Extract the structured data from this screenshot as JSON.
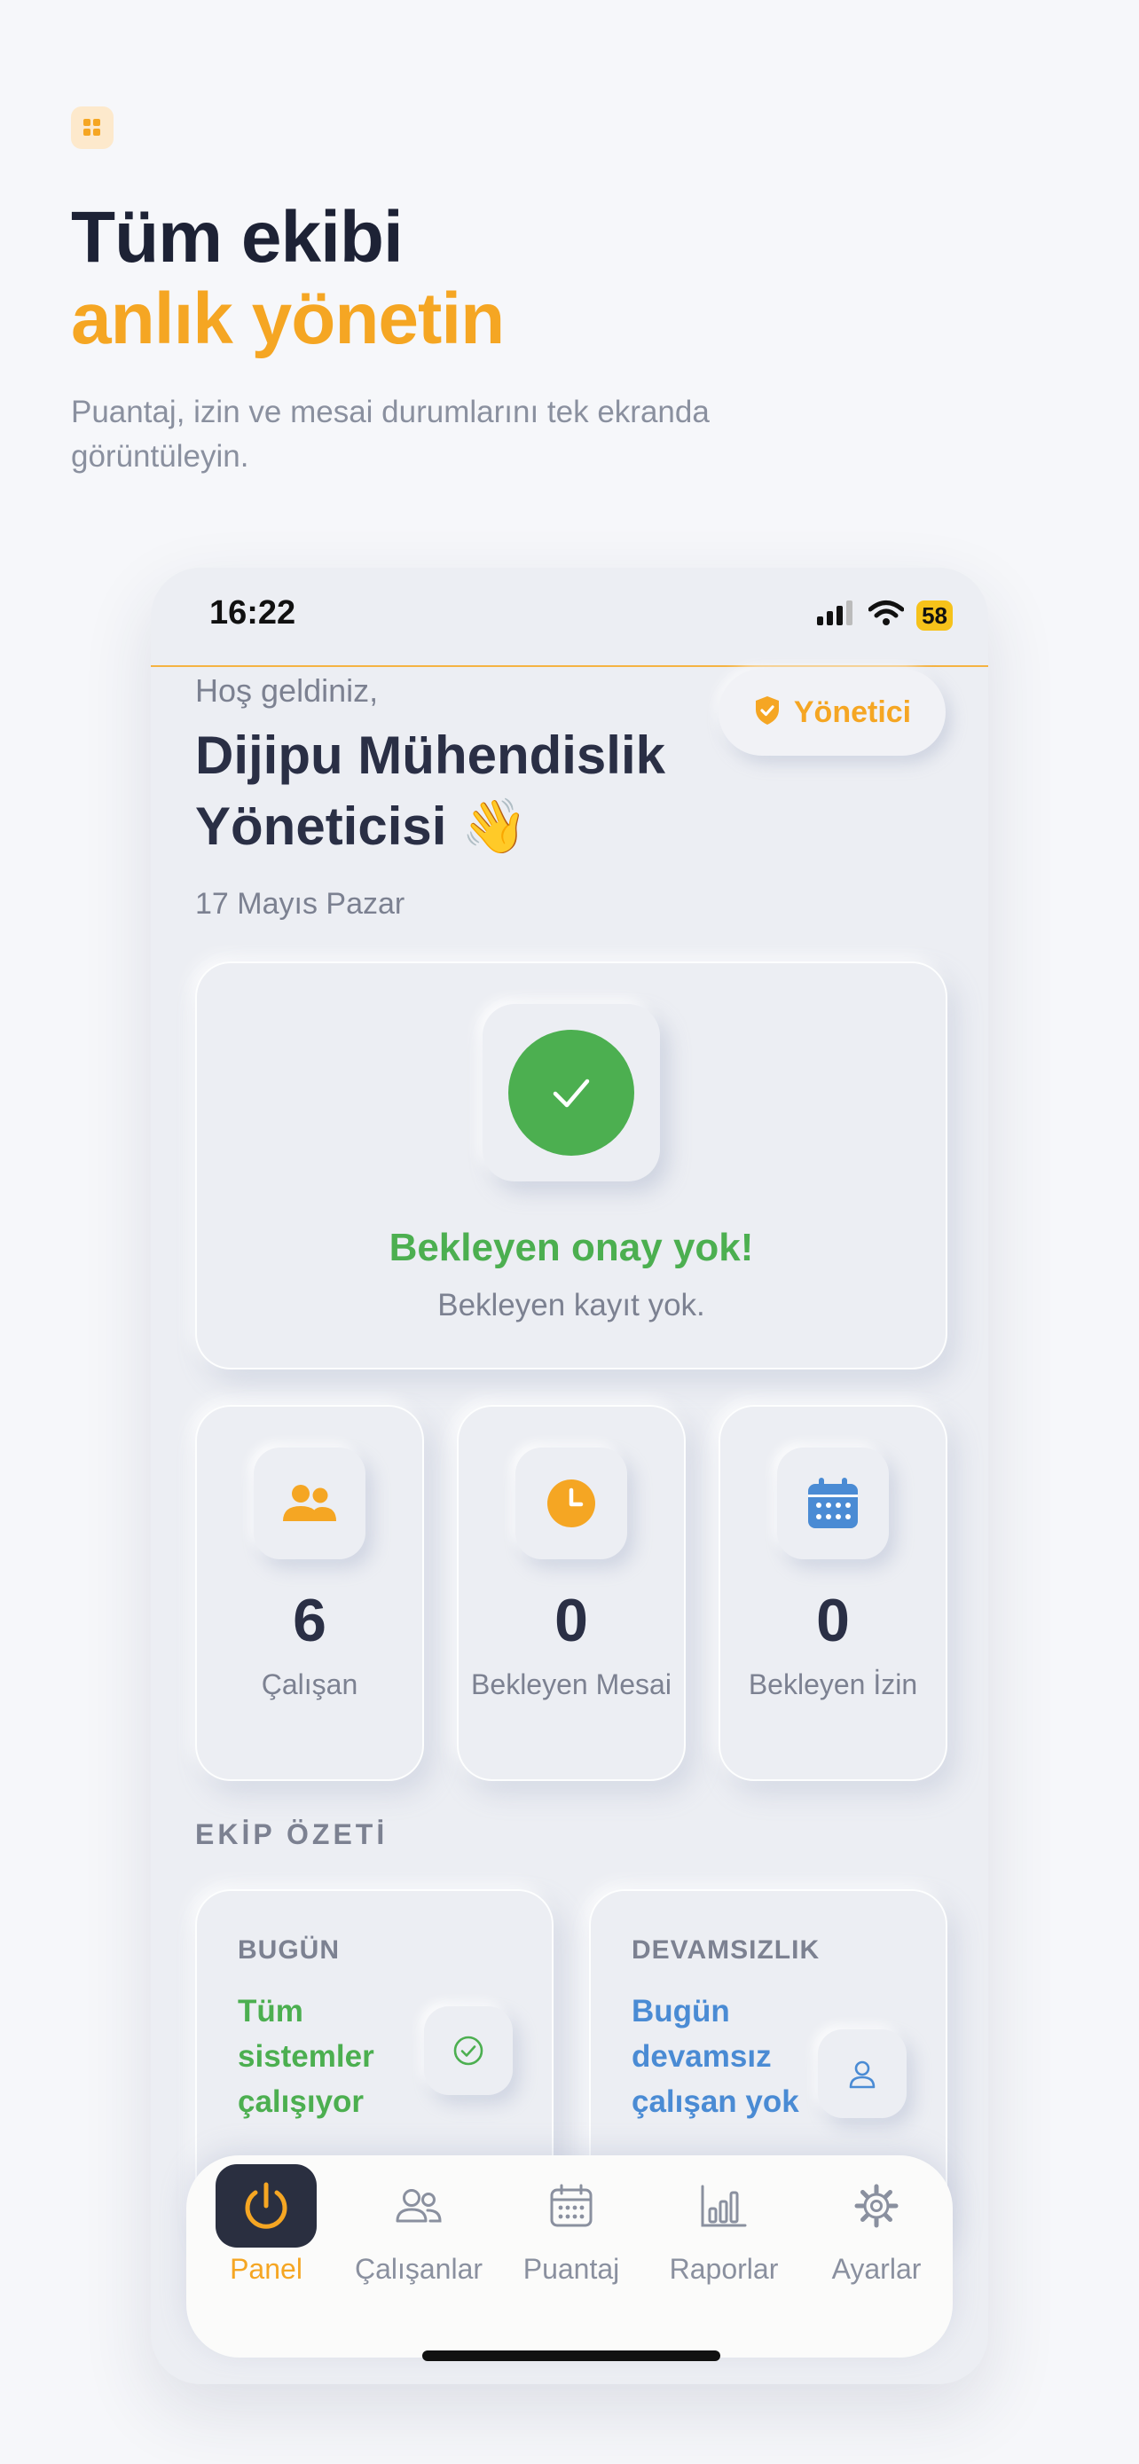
{
  "hero": {
    "title_line1": "Tüm ekibi",
    "title_line2": "anlık yönetin",
    "subtitle": "Puantaj, izin ve mesai durumlarını tek ekranda görüntüleyin."
  },
  "status_bar": {
    "time": "16:22",
    "battery": "58"
  },
  "header": {
    "welcome": "Hoş geldiniz,",
    "company": "Dijipu Mühendislik Yöneticisi 👋",
    "date": "17 Mayıs Pazar",
    "role_badge": "Yönetici"
  },
  "approval": {
    "title": "Bekleyen onay yok!",
    "subtitle": "Bekleyen kayıt yok."
  },
  "stats": [
    {
      "value": "6",
      "label": "Çalışan",
      "icon": "users-icon"
    },
    {
      "value": "0",
      "label": "Bekleyen Mesai",
      "icon": "clock-icon"
    },
    {
      "value": "0",
      "label": "Bekleyen İzin",
      "icon": "calendar-icon"
    }
  ],
  "section": {
    "title": "EKİP ÖZETİ"
  },
  "summary": [
    {
      "label": "BUGÜN",
      "text": "Tüm sistemler çalışıyor",
      "color": "#4caf50",
      "icon": "check-circle-icon"
    },
    {
      "label": "DEVAMSIZLIK",
      "text": "Bugün devamsız çalışan yok",
      "color": "#4a8bd4",
      "icon": "user-icon"
    }
  ],
  "tabs": [
    {
      "label": "Panel",
      "icon": "power-icon",
      "active": true
    },
    {
      "label": "Çalışanlar",
      "icon": "users-icon"
    },
    {
      "label": "Puantaj",
      "icon": "calendar-icon"
    },
    {
      "label": "Raporlar",
      "icon": "bar-chart-icon"
    },
    {
      "label": "Ayarlar",
      "icon": "gear-icon"
    }
  ],
  "colors": {
    "accent": "#f5a623",
    "success": "#4caf50",
    "info": "#4a8bd4",
    "dark": "#2a2f45"
  }
}
